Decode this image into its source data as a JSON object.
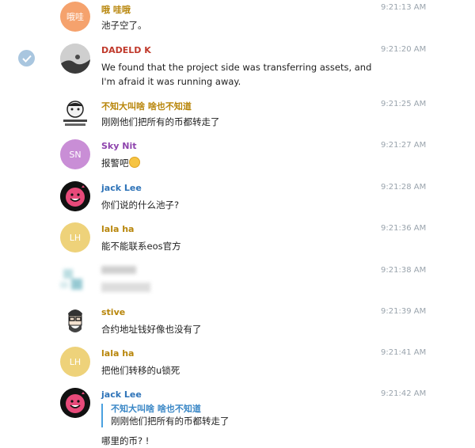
{
  "colors": {
    "name_default": "#b8860b",
    "name_red": "#c0392b",
    "name_purple": "#8e44ad",
    "name_blue": "#2e73b8",
    "time": "#9aa4ad",
    "check": "#a9c6df"
  },
  "messages": [
    {
      "name": "哦 哇哦",
      "avatar_text": "哦哇",
      "avatar_color": "#f5a26d",
      "time": "9:21:13 AM",
      "text": "池子空了。"
    },
    {
      "name": "DADELD K",
      "avatar_icon": "dark-landscape-avatar-icon",
      "time": "9:21:20 AM",
      "text": "We found that the project side was transferring assets, and I'm afraid it was running away.",
      "selected": true
    },
    {
      "name": "不知大叫啥 啥也不知道",
      "avatar_icon": "cartoon-meme-avatar-icon",
      "time": "9:21:25 AM",
      "text": "刚刚他们把所有的币都转走了"
    },
    {
      "name": "Sky Nit",
      "avatar_text": "SN",
      "avatar_color": "#c98ed6",
      "time": "9:21:27 AM",
      "text": "报警吧",
      "emoji": "smiling-face-emoji"
    },
    {
      "name": "jack Lee",
      "avatar_icon": "pink-smiley-avatar-icon",
      "time": "9:21:28 AM",
      "text": "你们说的什么池子?"
    },
    {
      "name": "lala ha",
      "avatar_text": "LH",
      "avatar_color": "#eed27a",
      "time": "9:21:36 AM",
      "text": "能不能联系eos官方"
    },
    {
      "name": "",
      "avatar_icon": "blurred-avatar-icon",
      "time": "9:21:38 AM",
      "text": "",
      "blurred": true
    },
    {
      "name": "stive",
      "avatar_icon": "bearded-man-avatar-icon",
      "time": "9:21:39 AM",
      "text": "合约地址钱好像也没有了"
    },
    {
      "name": "lala ha",
      "avatar_text": "LH",
      "avatar_color": "#eed27a",
      "time": "9:21:41 AM",
      "text": "把他们转移的u锁死"
    },
    {
      "name": "jack Lee",
      "avatar_icon": "pink-smiley-avatar-icon",
      "time": "9:21:42 AM",
      "reply": {
        "name": "不知大叫啥 啥也不知道",
        "text": "刚刚他们把所有的币都转走了"
      },
      "text": "哪里的币? !"
    }
  ]
}
